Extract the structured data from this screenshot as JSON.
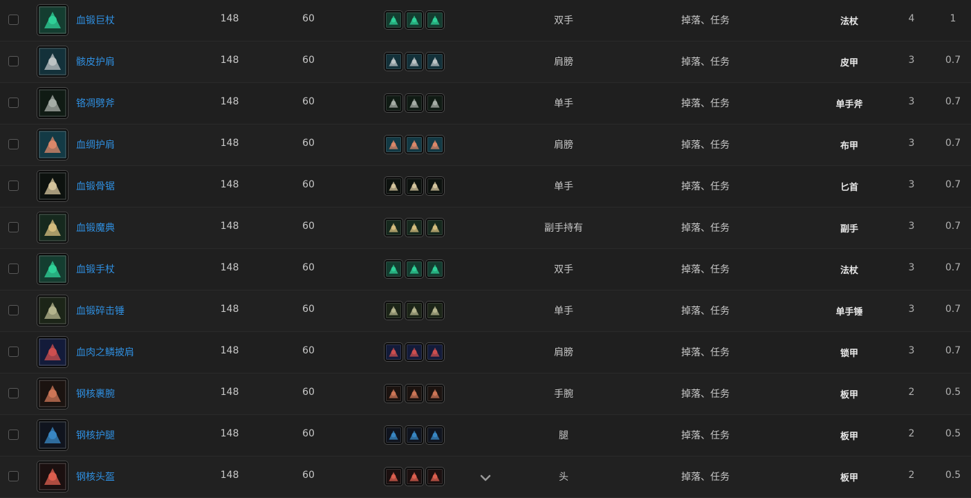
{
  "rows": [
    {
      "name": "血锻巨杖",
      "ilvl": "148",
      "req": "60",
      "slot": "双手",
      "source": "掉落、任务",
      "type": "法杖",
      "n1": "4",
      "n2": "1",
      "icon": "staff-gem-icon",
      "c1": "#1f5e4a",
      "c2": "#2fd49a"
    },
    {
      "name": "骸皮护肩",
      "ilvl": "148",
      "req": "60",
      "slot": "肩膀",
      "source": "掉落、任务",
      "type": "皮甲",
      "n1": "3",
      "n2": "0.7",
      "icon": "leather-shoulder-icon",
      "c1": "#1e4c5a",
      "c2": "#c0c6c8"
    },
    {
      "name": "铬凋劈斧",
      "ilvl": "148",
      "req": "60",
      "slot": "单手",
      "source": "掉落、任务",
      "type": "单手斧",
      "n1": "3",
      "n2": "0.7",
      "icon": "axe-icon",
      "c1": "#1a2a1f",
      "c2": "#a9b0aa"
    },
    {
      "name": "血绸护肩",
      "ilvl": "148",
      "req": "60",
      "slot": "肩膀",
      "source": "掉落、任务",
      "type": "布甲",
      "n1": "3",
      "n2": "0.7",
      "icon": "cloth-shoulder-icon",
      "c1": "#1e5a6a",
      "c2": "#e08a6a"
    },
    {
      "name": "血锻骨锯",
      "ilvl": "148",
      "req": "60",
      "slot": "单手",
      "source": "掉落、任务",
      "type": "匕首",
      "n1": "3",
      "n2": "0.7",
      "icon": "bone-saw-icon",
      "c1": "#141c18",
      "c2": "#d8c8a0"
    },
    {
      "name": "血锻魔典",
      "ilvl": "148",
      "req": "60",
      "slot": "副手持有",
      "source": "掉落、任务",
      "type": "副手",
      "n1": "3",
      "n2": "0.7",
      "icon": "tome-icon",
      "c1": "#23402e",
      "c2": "#d8c080"
    },
    {
      "name": "血锻手杖",
      "ilvl": "148",
      "req": "60",
      "slot": "双手",
      "source": "掉落、任务",
      "type": "法杖",
      "n1": "3",
      "n2": "0.7",
      "icon": "staff-gem-icon",
      "c1": "#1f5e4a",
      "c2": "#2fd49a"
    },
    {
      "name": "血锻碎击锤",
      "ilvl": "148",
      "req": "60",
      "slot": "单手",
      "source": "掉落、任务",
      "type": "单手锤",
      "n1": "3",
      "n2": "0.7",
      "icon": "mace-icon",
      "c1": "#2c3a26",
      "c2": "#b8b890"
    },
    {
      "name": "血肉之鳞披肩",
      "ilvl": "148",
      "req": "60",
      "slot": "肩膀",
      "source": "掉落、任务",
      "type": "锁甲",
      "n1": "3",
      "n2": "0.7",
      "icon": "mail-shoulder-icon",
      "c1": "#1e2a5a",
      "c2": "#d05050"
    },
    {
      "name": "钢核裹腕",
      "ilvl": "148",
      "req": "60",
      "slot": "手腕",
      "source": "掉落、任务",
      "type": "板甲",
      "n1": "2",
      "n2": "0.5",
      "icon": "bracer-icon",
      "c1": "#2a1e1a",
      "c2": "#d07858"
    },
    {
      "name": "钢核护腿",
      "ilvl": "148",
      "req": "60",
      "slot": "腿",
      "source": "掉落、任务",
      "type": "板甲",
      "n1": "2",
      "n2": "0.5",
      "icon": "plate-legs-icon",
      "c1": "#1a1f2e",
      "c2": "#3a8ac8"
    },
    {
      "name": "钢核头盔",
      "ilvl": "148",
      "req": "60",
      "slot": "头",
      "source": "掉落、任务",
      "type": "板甲",
      "n1": "2",
      "n2": "0.5",
      "icon": "helm-icon",
      "c1": "#2a1a1a",
      "c2": "#e06050"
    }
  ]
}
